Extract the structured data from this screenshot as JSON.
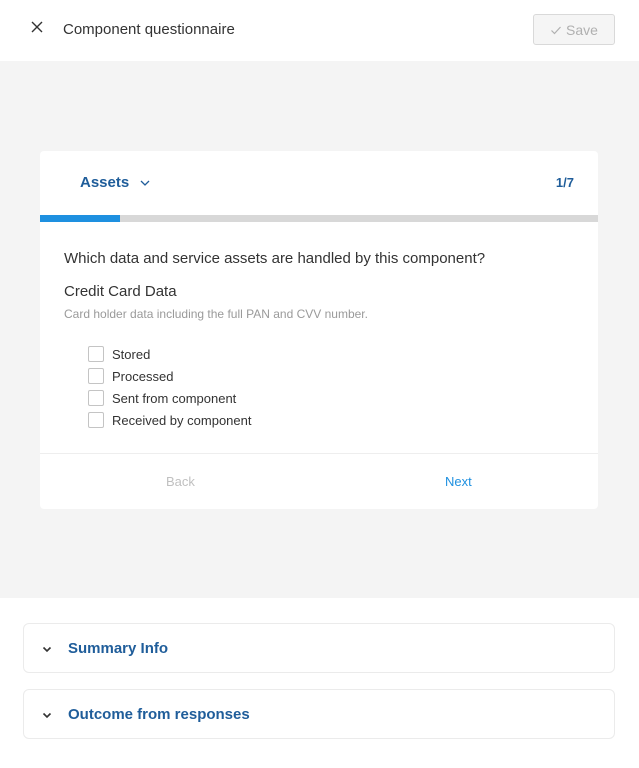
{
  "header": {
    "title": "Component questionnaire",
    "save_label": "Save"
  },
  "card": {
    "section_label": "Assets",
    "step_counter": "1/7",
    "progress": 0.1433,
    "question": "Which data and service assets are handled by this component?",
    "asset_title": "Credit Card Data",
    "asset_description": "Card holder data including the full PAN and CVV number.",
    "options": [
      {
        "label": "Stored",
        "checked": false
      },
      {
        "label": "Processed",
        "checked": false
      },
      {
        "label": "Sent from component",
        "checked": false
      },
      {
        "label": "Received by component",
        "checked": false
      }
    ],
    "back_label": "Back",
    "next_label": "Next"
  },
  "accordions": [
    {
      "label": "Summary Info"
    },
    {
      "label": "Outcome from responses"
    }
  ],
  "colors": {
    "accent_blue": "#1f5d9a",
    "progress_blue": "#1e90e0",
    "background_gray": "#f4f4f4"
  },
  "icons": {
    "close": "close-icon",
    "save": "check-icon",
    "section_dropdown": "chevron-down-icon",
    "accordion": "chevron-down-icon"
  }
}
